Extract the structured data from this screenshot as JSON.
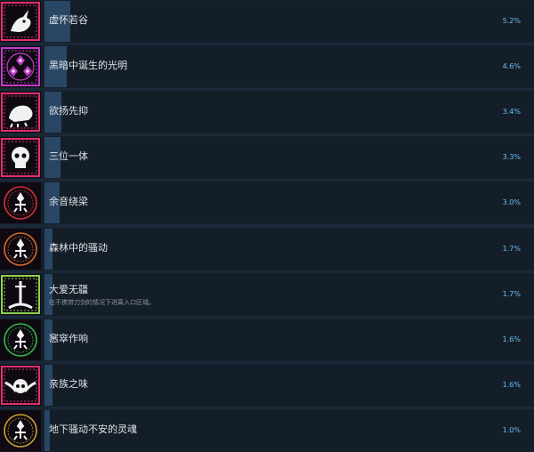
{
  "achievements": [
    {
      "name": "虚怀若谷",
      "desc": "",
      "percent_label": "5.2%",
      "percent": 5.2,
      "icon": "horned-beast-icon",
      "accent": "#e0306e"
    },
    {
      "name": "黑暗中诞生的光明",
      "desc": "",
      "percent_label": "4.6%",
      "percent": 4.6,
      "icon": "triple-rune-icon",
      "accent": "#c03ec8"
    },
    {
      "name": "欲扬先抑",
      "desc": "",
      "percent_label": "3.4%",
      "percent": 3.4,
      "icon": "crawling-beast-icon",
      "accent": "#e0306e"
    },
    {
      "name": "三位一体",
      "desc": "",
      "percent_label": "3.3%",
      "percent": 3.3,
      "icon": "skull-sigil-icon",
      "accent": "#e0306e"
    },
    {
      "name": "余音绕梁",
      "desc": "",
      "percent_label": "3.0%",
      "percent": 3.0,
      "icon": "red-fleur-sigil-icon",
      "accent": "#d03232"
    },
    {
      "name": "森林中的骚动",
      "desc": "",
      "percent_label": "1.7%",
      "percent": 1.7,
      "icon": "orange-fleur-sigil-icon",
      "accent": "#d86a2a"
    },
    {
      "name": "大爱无疆",
      "desc": "在不携带刀剑的情况下进离入口区域。",
      "percent_label": "1.7%",
      "percent": 1.7,
      "icon": "sword-spire-icon",
      "accent": "#8fd14f"
    },
    {
      "name": "窸窣作响",
      "desc": "",
      "percent_label": "1.6%",
      "percent": 1.6,
      "icon": "green-fleur-sigil-icon",
      "accent": "#33b84a"
    },
    {
      "name": "亲族之味",
      "desc": "",
      "percent_label": "1.6%",
      "percent": 1.6,
      "icon": "winged-skull-icon",
      "accent": "#e0306e"
    },
    {
      "name": "地下骚动不安的灵魂",
      "desc": "",
      "percent_label": "1.0%",
      "percent": 1.0,
      "icon": "gold-fleur-sigil-icon",
      "accent": "#c9a12e"
    }
  ]
}
